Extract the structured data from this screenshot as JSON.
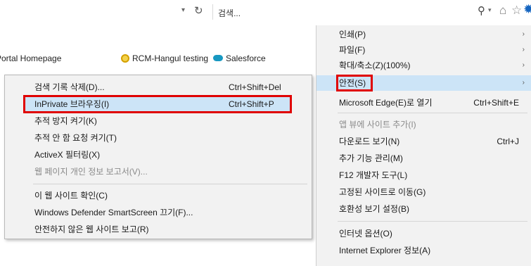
{
  "search": {
    "placeholder": "검색..."
  },
  "favorites": {
    "items": [
      {
        "label": "Portal Homepage"
      },
      {
        "label": "RCM-Hangul testing"
      },
      {
        "label": "Salesforce"
      }
    ]
  },
  "tools_menu": {
    "items": [
      {
        "label": "인쇄(P)",
        "has_submenu": true
      },
      {
        "label": "파일(F)",
        "has_submenu": true
      },
      {
        "label": "확대/축소(Z)(100%)",
        "has_submenu": true
      },
      {
        "label": "안전(S)",
        "has_submenu": true,
        "selected": true
      },
      {
        "label": "Microsoft Edge(E)로 열기",
        "shortcut": "Ctrl+Shift+E"
      },
      {
        "label": "앱 뷰에 사이트 추가(I)",
        "disabled": true
      },
      {
        "label": "다운로드 보기(N)",
        "shortcut": "Ctrl+J"
      },
      {
        "label": "추가 기능 관리(M)"
      },
      {
        "label": "F12 개발자 도구(L)"
      },
      {
        "label": "고정된 사이트로 이동(G)"
      },
      {
        "label": "호환성 보기 설정(B)"
      },
      {
        "label": "인터넷 옵션(O)"
      },
      {
        "label": "Internet Explorer 정보(A)"
      }
    ]
  },
  "safety_submenu": {
    "items": [
      {
        "label": "검색 기록 삭제(D)...",
        "shortcut": "Ctrl+Shift+Del"
      },
      {
        "label": "InPrivate 브라우징(I)",
        "shortcut": "Ctrl+Shift+P",
        "highlighted": true
      },
      {
        "label": "추적 방지 켜기(K)"
      },
      {
        "label": "추적 안 함 요청 켜기(T)"
      },
      {
        "label": "ActiveX 필터링(X)"
      },
      {
        "label": "웹 페이지 개인 정보 보고서(V)...",
        "disabled": true
      },
      {
        "label": "이 웹 사이트 확인(C)"
      },
      {
        "label": "Windows Defender SmartScreen 끄기(F)..."
      },
      {
        "label": "안전하지 않은 웹 사이트 보고(R)"
      }
    ]
  },
  "colors": {
    "highlight": "#cce4f7",
    "annotation_red": "#e00000",
    "menu_bg": "#f2f2f2"
  },
  "icons": {
    "refresh": "refresh-icon",
    "search": "search-icon",
    "home": "home-icon",
    "favorites": "star-icon",
    "tools": "gear-icon"
  }
}
